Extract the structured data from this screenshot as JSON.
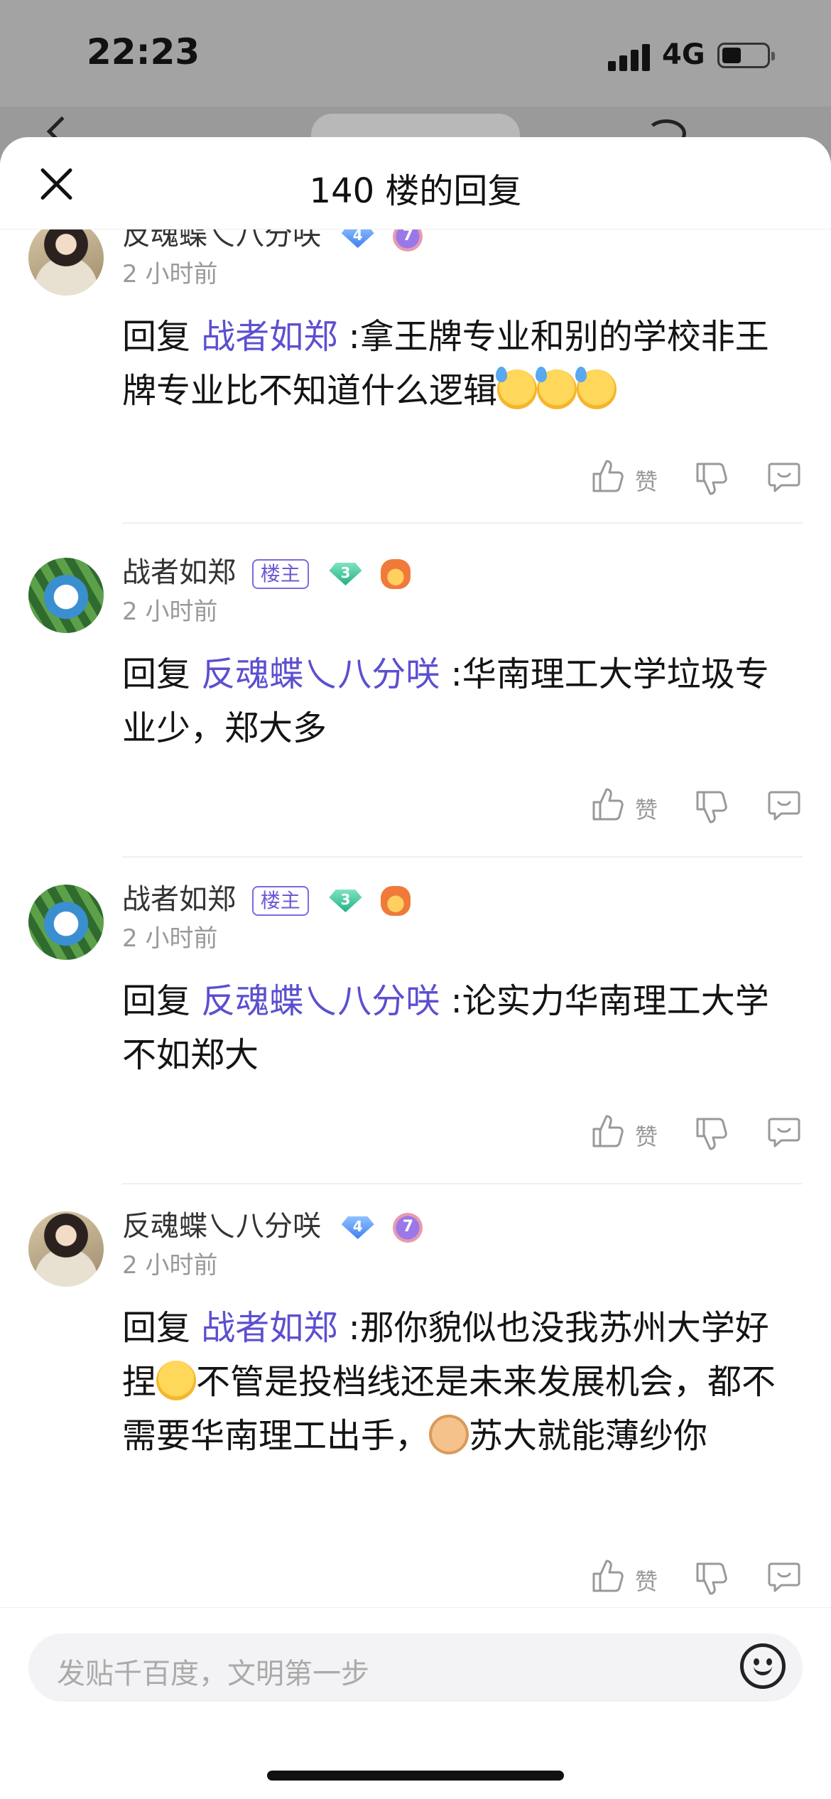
{
  "status": {
    "time": "22:23",
    "network": "4G"
  },
  "sheet": {
    "title": "140 楼的回复"
  },
  "actions_text": {
    "like": "赞"
  },
  "comments": [
    {
      "user": "反魂蝶乀八分咲",
      "gem_level": "4",
      "medal_level": "7",
      "time": "2 小时前",
      "reply_prefix": "回复",
      "mention": "战者如郑",
      "text_a": ":拿王牌专业和别的学校非王牌专业比不知道什么逻辑"
    },
    {
      "user": "战者如郑",
      "owner_badge": "楼主",
      "gem_level": "3",
      "time": "2 小时前",
      "reply_prefix": "回复",
      "mention": "反魂蝶乀八分咲",
      "text_a": ":华南理工大学垃圾专业少，郑大多"
    },
    {
      "user": "战者如郑",
      "owner_badge": "楼主",
      "gem_level": "3",
      "time": "2 小时前",
      "reply_prefix": "回复",
      "mention": "反魂蝶乀八分咲",
      "text_a": ":论实力华南理工大学不如郑大"
    },
    {
      "user": "反魂蝶乀八分咲",
      "gem_level": "4",
      "medal_level": "7",
      "time": "2 小时前",
      "reply_prefix": "回复",
      "mention": "战者如郑",
      "text_a": ":那你貌似也没我苏州大学好捏",
      "text_b": "不管是投档线还是未来发展机会，都不需要华南理工出手，",
      "text_c": "苏大就能薄纱你"
    }
  ],
  "composer": {
    "placeholder": "发贴千百度，文明第一步"
  },
  "icons": {
    "close": "close-icon",
    "like": "thumbs-up-icon",
    "dislike": "thumbs-down-icon",
    "reply": "comment-bubble-icon",
    "emoji": "smiley-icon"
  }
}
